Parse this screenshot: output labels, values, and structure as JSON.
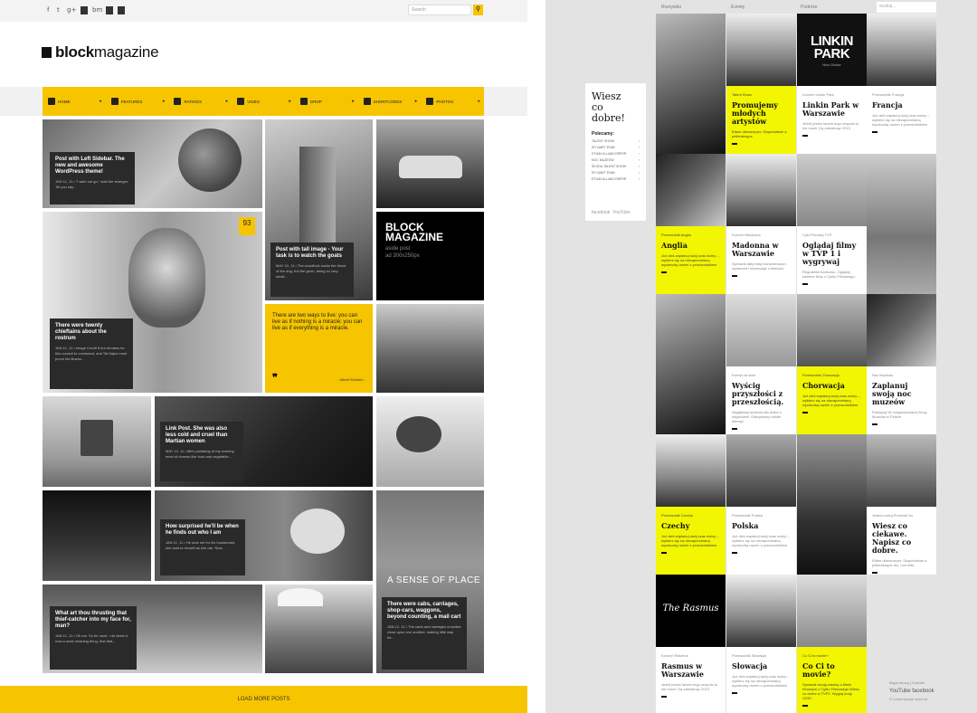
{
  "left": {
    "social_icons": [
      "f",
      "t",
      "g+",
      "rss",
      "bm",
      "ig",
      "yt"
    ],
    "search_placeholder": "Search",
    "logo": {
      "bold": "block",
      "light": "magazine"
    },
    "nav": [
      {
        "label": "HOME",
        "icon": "home-icon"
      },
      {
        "label": "FEATURES",
        "icon": "gears-icon"
      },
      {
        "label": "RATINGS",
        "icon": "list-icon"
      },
      {
        "label": "VIDEO",
        "icon": "play-icon"
      },
      {
        "label": "DROP",
        "icon": "menu-icon"
      },
      {
        "label": "SHORTCODES",
        "icon": "globe-icon"
      },
      {
        "label": "PHOTOS",
        "icon": "camera-icon"
      }
    ],
    "posts": [
      {
        "title": "Post with Left Sidebar. The new and awesome WordPress theme!",
        "excerpt": "JAN 11, 11 • \"I wish not go,\" said the stranger, \"till you say..."
      },
      {
        "title": "Post with tall image - Your task is to watch the goats",
        "excerpt": "MAY 10, 11 • The woodlock sucks the blood of the dog, but the germ, being so very small..."
      },
      {
        "title": "There were twenty chieftains about the rostrum",
        "excerpt": "JAN 11, 11 • Image Credit It but remains for this council to command, and Tal Hajus must prove his fitness..."
      },
      {
        "title": "Link Post. She was also less cold and cruel than Martian women",
        "excerpt": "MAY 12, 11 • After partaking of my evening meal of cheese-like food and vegetable..."
      },
      {
        "title": "How surprised he'll be when he finds out who I am",
        "excerpt": "JAN 11, 11 • He took me for his housemaid, she said to herself as she ran. Now..."
      },
      {
        "title": "What art thou thrusting that thief-catcher into my face for, man?",
        "excerpt": "JAN 11, 11 • Oh me. So he must. I do deem it now a most meaning thing, that that..."
      },
      {
        "title": "There were cabs, carriages, shop-cars, waggons, beyond counting, a mail cart",
        "excerpt": "JAN 12, 11 • The carts and carriages crowded close upon one another, making little way for..."
      }
    ],
    "rating": "93",
    "block_ad": {
      "title": "BLOCK MAGAZINE",
      "sub1": "aside post",
      "sub2": "ad 300x250px"
    },
    "quote": {
      "text": "There are two ways to live: you can live as if nothing is a miracle; you can live as if everything is a miracle.",
      "author": "- Albert Einstein -"
    },
    "sense_of_place": "A SENSE OF PLACE",
    "load_more": "LOAD MORE POSTS"
  },
  "right": {
    "top_links": [
      "Rozrywka",
      "Eventy",
      "Podróże"
    ],
    "search_placeholder": "szukaj...",
    "sidebox": {
      "title_line1": "Wiesz",
      "title_line2": "co dobre!",
      "label": "Polecamy:",
      "items": [
        "TALENT SHOW",
        "SIT AMET ENIM",
        "ETIAM ULLAMCORPER",
        "NOC MUZEÓW",
        "ŚKODA TALENT SHOW",
        "SIT AMET ENIM",
        "ETIAM ULLAMCORPER"
      ],
      "facebook": "facebook",
      "youtube": "YouTube"
    },
    "cards": [
      {
        "cat": "Talent Show",
        "title": "Promujemy młodych artystów",
        "text": "Etiam ullamcorper. Suspendisse a pellentesque.",
        "yellow": true
      },
      {
        "cat": "Koncert Linkin Park",
        "title": "Linkin Park w Warszawie",
        "text": "Jeżeli jesteś fanem tego zespołu to nie może Cię zabraknąć 2013",
        "yellow": false
      },
      {
        "cat": "Przewodnik Francja",
        "title": "Francja",
        "text": "Już dziś zaplanuj swój czas wolny – wybierz się na niezapomnianą wycieczkę razem z przewodnikiem",
        "yellow": false
      },
      {
        "cat": "Przewodnik Anglia",
        "title": "Anglia",
        "text": "Już dziś zaplanuj swój czas wolny – wybierz się na niezapomnianą wycieczkę razem z przewodnikiem",
        "yellow": true
      },
      {
        "cat": "Koncert Madonna",
        "title": "Madonna w Warszawie",
        "text": "Sprawdź daty trasy koncertowych, wydarzeń i informacje o biletach.",
        "yellow": false
      },
      {
        "cat": "Cykl Filmowy TVP",
        "title": "Oglądaj filmy w TVP 1 i wygrywaj",
        "text": "Regulamin konkursu. Oglądaj świetne filmy z Cyklu Filmowego.",
        "yellow": false
      },
      {
        "cat": "Kredyt na start",
        "title": "Wyścig przyszłości z przeszłością.",
        "text": "Wyjątkowy konkurs dla dzieci z nagrodami. Odkrywamy młode talenty!",
        "yellow": false
      },
      {
        "cat": "Przewodnik Chorwacja",
        "title": "Chorwacja",
        "text": "Już dziś zaplanuj swój czas wolny – wybierz się na niezapomnianą wycieczkę razem z przewodnikiem",
        "yellow": true
      },
      {
        "cat": "Noc Muzeów",
        "title": "Zaplanuj swoją noc muzeów",
        "text": "Pamiętaj! W zorganizowanej Nocy Muzeów w Polsce",
        "yellow": false
      },
      {
        "cat": "Przewodnik Czechy",
        "title": "Czechy",
        "text": "Już dziś zaplanuj swój czas wolny – wybierz się na niezapomnianą wycieczkę razem z przewodnikiem",
        "yellow": true
      },
      {
        "cat": "Przewodnik Polska",
        "title": "Polska",
        "text": "Już dziś zaplanuj swój czas wolny – wybierz się na niezapomnianą wycieczkę razem z przewodnikiem",
        "yellow": false
      },
      {
        "cat": "Jestem sobą Przewód for",
        "title": "Wiesz co ciekawe. Napisz co dobre.",
        "text": "Etiam ullamcorper. Suspendisse a pellentesque dui, non felis.",
        "yellow": false
      },
      {
        "cat": "Koncert Rasmus",
        "title": "Rasmus w Warszawie",
        "text": "Jeżeli jesteś fanem tego zespołu to nie może Cię zabraknąć 2013",
        "yellow": false
      },
      {
        "cat": "Przewodnik Słowacja",
        "title": "Słowacja",
        "text": "Już dziś zaplanuj swój czas wolny – wybierz się na niezapomnianą wycieczkę razem z przewodnikiem",
        "yellow": false
      },
      {
        "cat": "Co Ci to movie?",
        "title": "Co Ci to movie?",
        "text": "Sprawdź swoją wiedzę o filmie Kinowym z Cyklu Filmowego Wiesz co dobre w TVP2. Wygraj kody VOD!",
        "yellow": true
      }
    ],
    "image_texts": {
      "linkin": "LINKIN PARK",
      "linkin_sub": "New Divide",
      "rasmus": "The Rasmus"
    },
    "footer": {
      "links": "Mapa strony | Kontakt",
      "yt": "YouTube",
      "fb": "facebook",
      "copy": "© Lorem ipsum dolor sit"
    }
  },
  "colors": {
    "accent_left": "#f6c500",
    "accent_right": "#f2f600"
  }
}
